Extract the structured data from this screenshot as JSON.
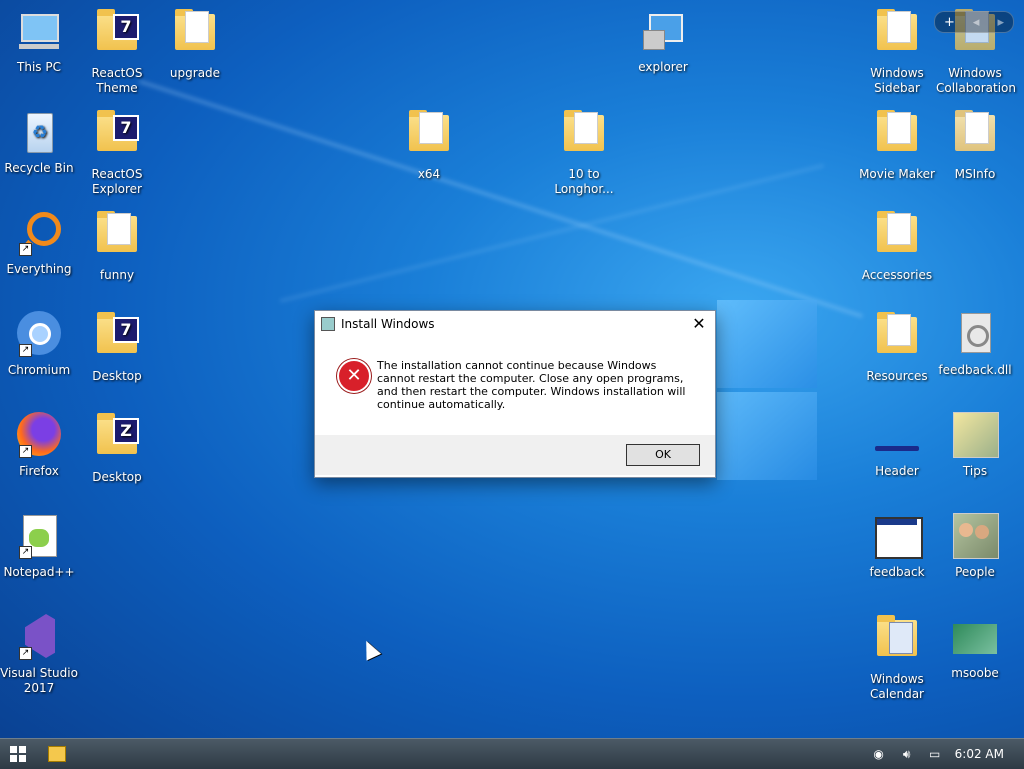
{
  "desktop_icons": {
    "this_pc": "This PC",
    "reactos_theme": "ReactOS Theme",
    "upgrade": "upgrade",
    "explorer": "explorer",
    "windows_sidebar": "Windows Sidebar",
    "windows_collaboration": "Windows Collaboration",
    "recycle_bin": "Recycle Bin",
    "reactos_explorer": "ReactOS Explorer",
    "x64": "x64",
    "ten_to_longhorn": "10 to Longhor...",
    "movie_maker": "Movie Maker",
    "msinfo": "MSInfo",
    "everything": "Everything",
    "funny": "funny",
    "accessories": "Accessories",
    "chromium": "Chromium",
    "desktop1": "Desktop",
    "resources": "Resources",
    "feedback_dll": "feedback.dll",
    "firefox": "Firefox",
    "desktop2": "Desktop",
    "header": "Header",
    "tips": "Tips",
    "notepadpp": "Notepad++",
    "feedback": "feedback",
    "people": "People",
    "visual_studio": "Visual Studio 2017",
    "windows_calendar": "Windows Calendar",
    "msoobe": "msoobe"
  },
  "dialog": {
    "title": "Install Windows",
    "message": "The installation cannot continue because Windows cannot restart the computer. Close any open programs, and then restart the computer. Windows installation will continue automatically.",
    "ok_label": "OK",
    "close_glyph": "✕"
  },
  "sidebar_ctrl": {
    "add": "+",
    "prev": "◂",
    "next": "▸"
  },
  "taskbar": {
    "clock": "6:02 AM"
  },
  "icons": {
    "error": "error-icon",
    "start": "windows-start-icon"
  }
}
